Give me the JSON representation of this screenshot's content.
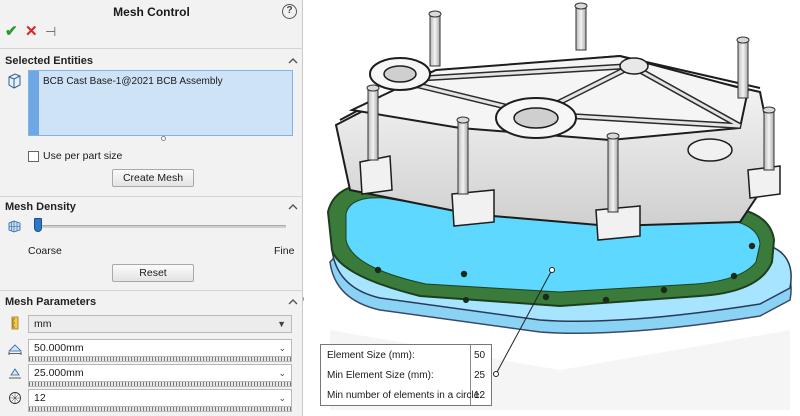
{
  "header": {
    "title": "Mesh Control",
    "help_icon": "question-circle-icon",
    "toolbar": {
      "ok_icon": "check-icon",
      "cancel_icon": "close-icon",
      "pin_icon": "pushpin-icon"
    }
  },
  "selected_entities": {
    "title": "Selected Entities",
    "items": [
      "BCB Cast Base-1@2021 BCB Assembly"
    ],
    "use_per_part_label": "Use per part size",
    "use_per_part_checked": false,
    "create_mesh_label": "Create Mesh"
  },
  "mesh_density": {
    "title": "Mesh Density",
    "coarse_label": "Coarse",
    "fine_label": "Fine",
    "slider_level": 0,
    "reset_label": "Reset"
  },
  "mesh_parameters": {
    "title": "Mesh Parameters",
    "unit": "mm",
    "element_size": "50.000mm",
    "min_element_size": "25.000mm",
    "min_elements_in_circle": "12"
  },
  "callout": {
    "rows": [
      {
        "label": "Element Size (mm):",
        "value": "50"
      },
      {
        "label": "Min Element Size (mm):",
        "value": "25"
      },
      {
        "label": "Min number of elements in a circle:",
        "value": "12"
      }
    ]
  },
  "colors": {
    "accent_blue": "#2f78c8",
    "selection_fill": "#cfe3f7",
    "mesh_highlight": "#5fd8ff",
    "edge_green": "#2e6b2a",
    "ok_green": "#2c9a2c",
    "cancel_red": "#dd2222"
  }
}
